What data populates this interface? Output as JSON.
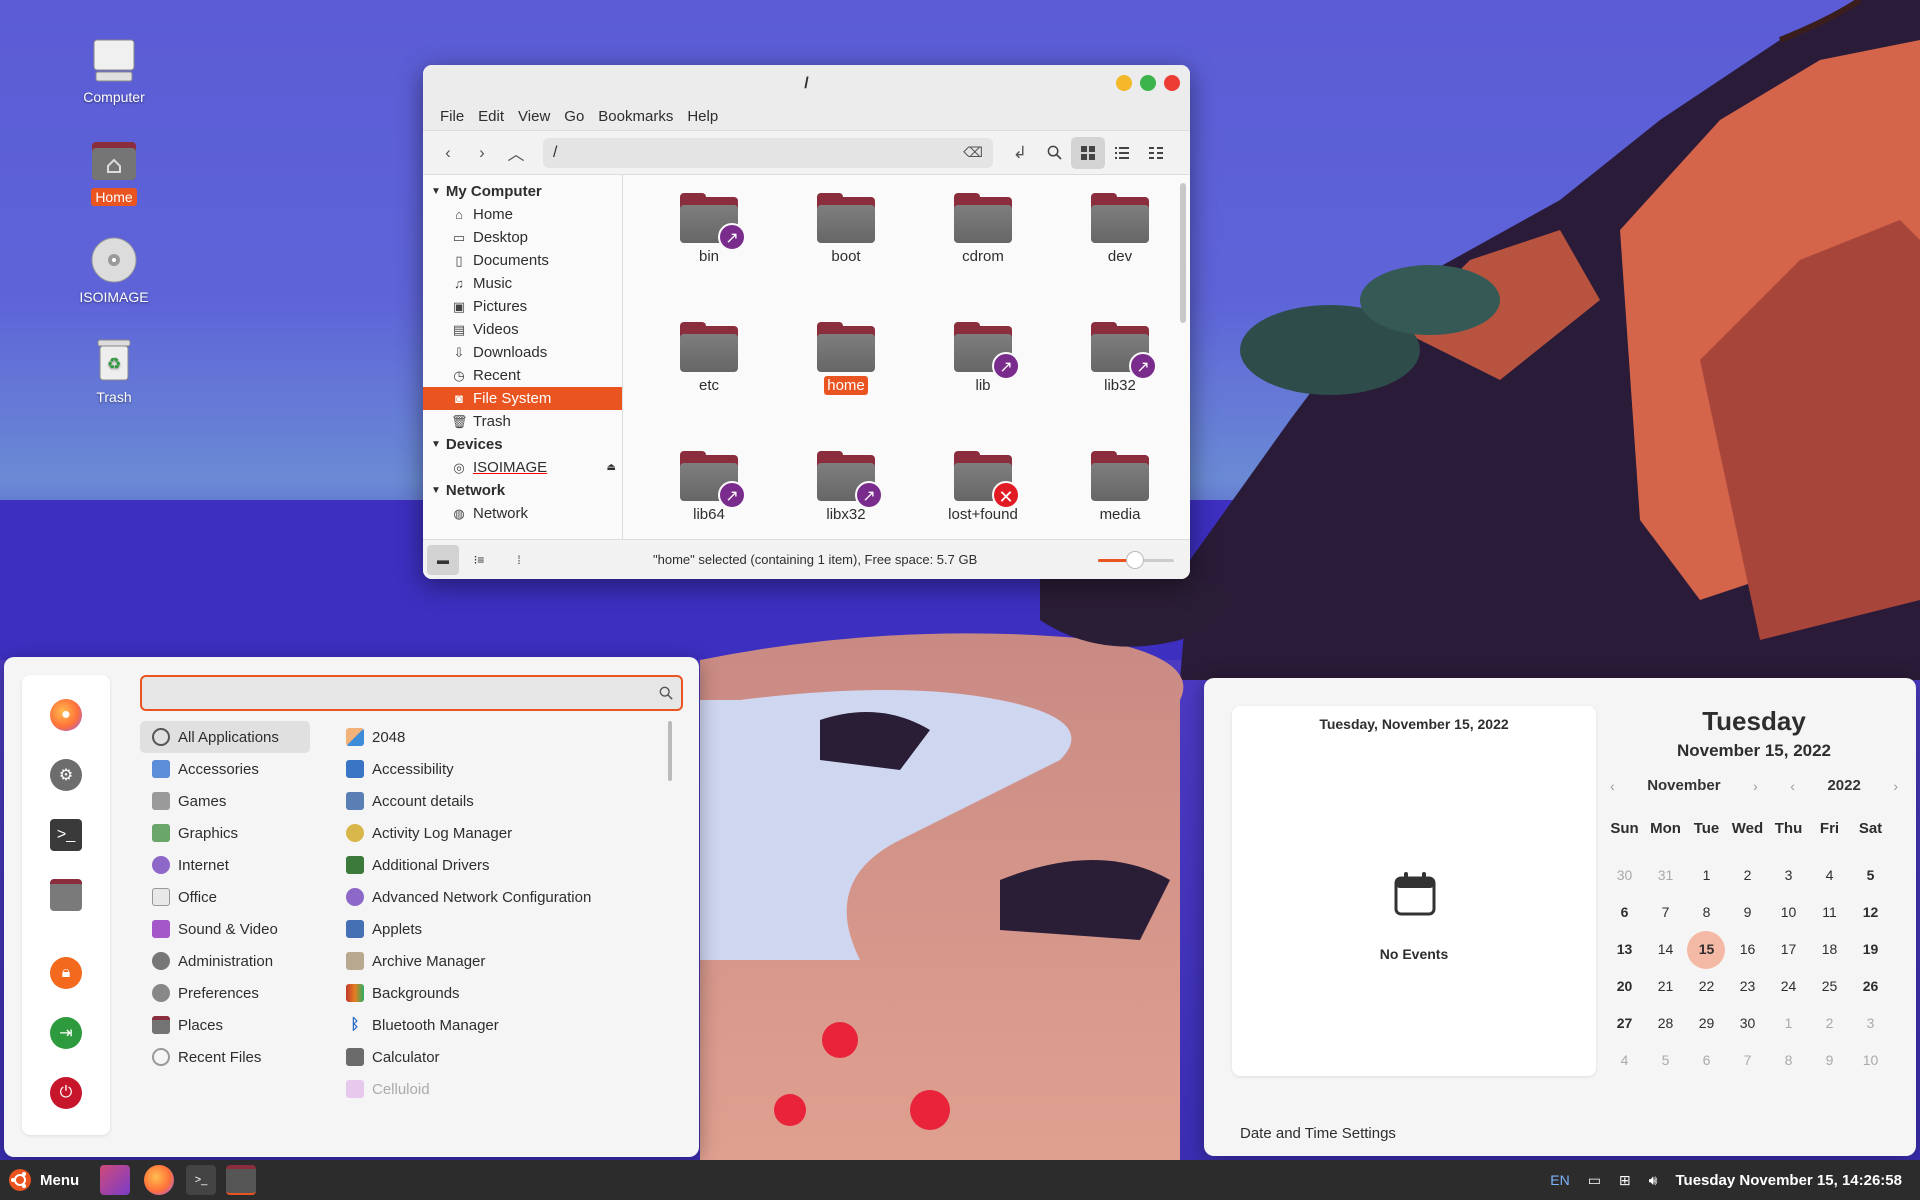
{
  "desktop": {
    "icons": [
      {
        "label": "Computer",
        "icon": "computer-icon"
      },
      {
        "label": "Home",
        "icon": "home-folder-icon"
      },
      {
        "label": "ISOIMAGE",
        "icon": "disc-icon"
      },
      {
        "label": "Trash",
        "icon": "trash-icon"
      }
    ]
  },
  "file_manager": {
    "title": "/",
    "menu": [
      "File",
      "Edit",
      "View",
      "Go",
      "Bookmarks",
      "Help"
    ],
    "path": "/",
    "sidebar": {
      "my_computer": "My Computer",
      "places": [
        "Home",
        "Desktop",
        "Documents",
        "Music",
        "Pictures",
        "Videos",
        "Downloads",
        "Recent",
        "File System",
        "Trash"
      ],
      "devices_header": "Devices",
      "devices": [
        "ISOIMAGE"
      ],
      "network_header": "Network",
      "network": [
        "Network"
      ]
    },
    "items": [
      "bin",
      "boot",
      "cdrom",
      "dev",
      "etc",
      "home",
      "lib",
      "lib32",
      "lib64",
      "libx32",
      "lost+found",
      "media"
    ],
    "selected_item": "home",
    "status": "\"home\" selected (containing 1 item), Free space: 5.7 GB",
    "colors": {
      "accent": "#e95420",
      "folder_tab": "#8a2d3d",
      "emblem": "#7a2c8c"
    }
  },
  "app_menu": {
    "search_placeholder": "",
    "categories": [
      "All Applications",
      "Accessories",
      "Games",
      "Graphics",
      "Internet",
      "Office",
      "Sound & Video",
      "Administration",
      "Preferences",
      "Places",
      "Recent Files"
    ],
    "apps": [
      "2048",
      "Accessibility",
      "Account details",
      "Activity Log Manager",
      "Additional Drivers",
      "Advanced Network Configuration",
      "Applets",
      "Archive Manager",
      "Backgrounds",
      "Bluetooth Manager",
      "Calculator",
      "Celluloid"
    ],
    "favorites": [
      "firefox-icon",
      "settings-icon",
      "terminal-icon",
      "files-icon",
      "lock-icon",
      "logout-icon",
      "power-icon"
    ]
  },
  "calendar": {
    "events_date": "Tuesday, November 15, 2022",
    "no_events": "No Events",
    "day_name": "Tuesday",
    "full_date": "November 15, 2022",
    "month": "November",
    "year": "2022",
    "weekdays": [
      "Sun",
      "Mon",
      "Tue",
      "Wed",
      "Thu",
      "Fri",
      "Sat"
    ],
    "days": [
      "30",
      "31",
      "1",
      "2",
      "3",
      "4",
      "5",
      "6",
      "7",
      "8",
      "9",
      "10",
      "11",
      "12",
      "13",
      "14",
      "15",
      "16",
      "17",
      "18",
      "19",
      "20",
      "21",
      "22",
      "23",
      "24",
      "25",
      "26",
      "27",
      "28",
      "29",
      "30",
      "1",
      "2",
      "3",
      "4",
      "5",
      "6",
      "7",
      "8",
      "9",
      "10"
    ],
    "today": "15",
    "settings_link": "Date and Time Settings"
  },
  "panel": {
    "menu_label": "Menu",
    "keyboard": "EN",
    "clock": "Tuesday November 15, 14:26:58"
  }
}
